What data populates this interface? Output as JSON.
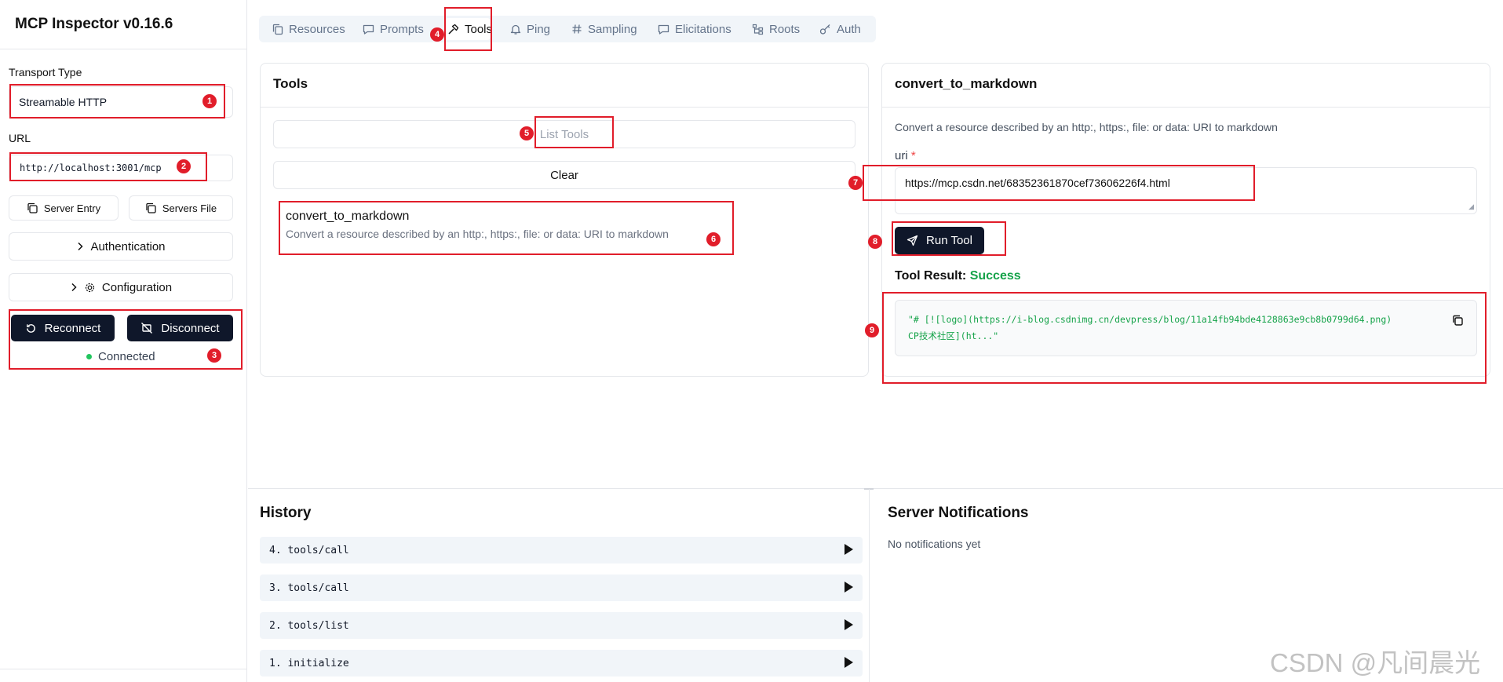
{
  "app": {
    "title": "MCP Inspector v0.16.6"
  },
  "sidebar": {
    "transport_label": "Transport Type",
    "transport_value": "Streamable HTTP",
    "url_label": "URL",
    "url_value": "http://localhost:3001/mcp",
    "server_entry": "Server Entry",
    "servers_file": "Servers File",
    "authentication": "Authentication",
    "configuration": "Configuration",
    "reconnect": "Reconnect",
    "disconnect": "Disconnect",
    "status": "Connected",
    "status_color": "#22c55e"
  },
  "tabs": [
    {
      "label": "Resources",
      "icon": "files-icon"
    },
    {
      "label": "Prompts",
      "icon": "message-icon"
    },
    {
      "label": "Tools",
      "icon": "hammer-icon",
      "active": true
    },
    {
      "label": "Ping",
      "icon": "bell-icon"
    },
    {
      "label": "Sampling",
      "icon": "hash-icon"
    },
    {
      "label": "Elicitations",
      "icon": "message-icon"
    },
    {
      "label": "Roots",
      "icon": "tree-icon"
    },
    {
      "label": "Auth",
      "icon": "key-icon"
    }
  ],
  "tools_panel": {
    "title": "Tools",
    "list_tools": "List Tools",
    "clear": "Clear",
    "tool_name": "convert_to_markdown",
    "tool_desc": "Convert a resource described by an http:, https:, file: or data: URI to markdown"
  },
  "detail_panel": {
    "title": "convert_to_markdown",
    "desc": "Convert a resource described by an http:, https:, file: or data: URI to markdown",
    "uri_label": "uri",
    "required_mark": "*",
    "uri_value": "https://mcp.csdn.net/68352361870cef73606226f4.html",
    "run_tool": "Run Tool",
    "result_label": "Tool Result:",
    "result_status": "Success",
    "result_line1": "\"# [![logo](https://i-blog.csdnimg.cn/devpress/blog/11a14fb94bde4128863e9cb8b0799d64.png)",
    "result_line2": "CP技术社区](ht...\""
  },
  "history": {
    "title": "History",
    "items": [
      "4. tools/call",
      "3. tools/call",
      "2. tools/list",
      "1. initialize"
    ]
  },
  "notifications": {
    "title": "Server Notifications",
    "empty": "No notifications yet"
  },
  "annotations": [
    "1",
    "2",
    "3",
    "4",
    "5",
    "6",
    "7",
    "8",
    "9"
  ],
  "watermark": "CSDN @凡间晨光",
  "colors": {
    "accent_dark": "#0f172a",
    "annotation_red": "#e11d2a",
    "success_green": "#16a34a",
    "result_text": "#16a34a"
  }
}
